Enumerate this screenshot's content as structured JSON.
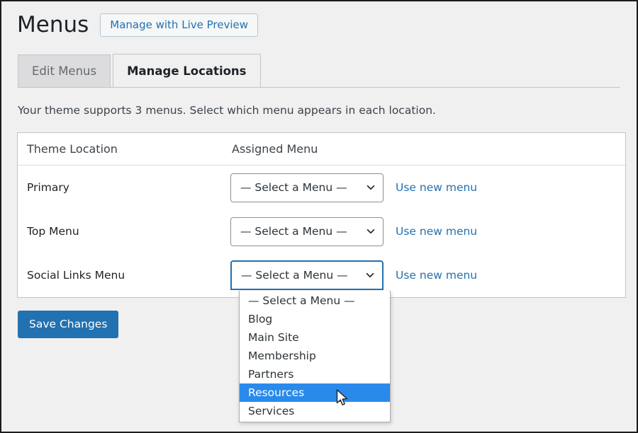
{
  "header": {
    "title": "Menus",
    "live_preview_button": "Manage with Live Preview"
  },
  "tabs": [
    {
      "label": "Edit Menus",
      "active": false
    },
    {
      "label": "Manage Locations",
      "active": true
    }
  ],
  "description": "Your theme supports 3 menus. Select which menu appears in each location.",
  "table": {
    "columns": {
      "location": "Theme Location",
      "assigned_menu": "Assigned Menu"
    },
    "rows": [
      {
        "location": "Primary",
        "select_value": "— Select a Menu —",
        "use_new_menu": "Use new menu",
        "focused": false
      },
      {
        "location": "Top Menu",
        "select_value": "— Select a Menu —",
        "use_new_menu": "Use new menu",
        "focused": false
      },
      {
        "location": "Social Links Menu",
        "select_value": "— Select a Menu —",
        "use_new_menu": "Use new menu",
        "focused": true
      }
    ]
  },
  "dropdown": {
    "open_for_row": "Social Links Menu",
    "options": [
      {
        "label": "— Select a Menu —",
        "highlighted": false
      },
      {
        "label": "Blog",
        "highlighted": false
      },
      {
        "label": "Main Site",
        "highlighted": false
      },
      {
        "label": "Membership",
        "highlighted": false
      },
      {
        "label": "Partners",
        "highlighted": false
      },
      {
        "label": "Resources",
        "highlighted": true
      },
      {
        "label": "Services",
        "highlighted": false
      }
    ]
  },
  "save_button": "Save Changes",
  "colors": {
    "accent_blue": "#2271b1",
    "highlight_blue": "#2a8aec",
    "page_background": "#f0f0f1",
    "panel_background": "#ffffff",
    "border_gray": "#c3c4c7",
    "text_dark": "#1d2327"
  }
}
